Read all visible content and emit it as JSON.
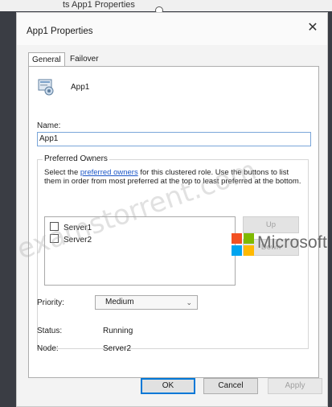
{
  "top_caption": "ts App1 Properties",
  "dialog": {
    "title": "App1 Properties",
    "tabs": [
      {
        "label": "General"
      },
      {
        "label": "Failover"
      }
    ],
    "app_name": "App1",
    "name_label": "Name:",
    "name_value": "App1",
    "preferred_owners": {
      "legend": "Preferred Owners",
      "desc_before": "Select the ",
      "desc_link": "preferred owners",
      "desc_after": " for this clustered role. Use the buttons to list them in order from most preferred at the top to least preferred at the bottom.",
      "servers": [
        {
          "label": "Server1",
          "checked": false
        },
        {
          "label": "Server2",
          "checked": false
        }
      ],
      "up_label": "Up",
      "down_label": "Down"
    },
    "priority_label": "Priority:",
    "priority_value": "Medium",
    "status_label": "Status:",
    "status_value": "Running",
    "node_label": "Node:",
    "node_value": "Server2",
    "buttons": {
      "ok": "OK",
      "cancel": "Cancel",
      "apply": "Apply"
    }
  },
  "overlay": {
    "watermark": "examstorrent.com",
    "brand_text": "Microsoft",
    "brand_colors": [
      "#f25022",
      "#7fba00",
      "#00a4ef",
      "#ffb900"
    ]
  },
  "icons": {
    "close": "close-icon",
    "app": "clustered-role-icon",
    "dropdown": "chevron-down-icon"
  }
}
